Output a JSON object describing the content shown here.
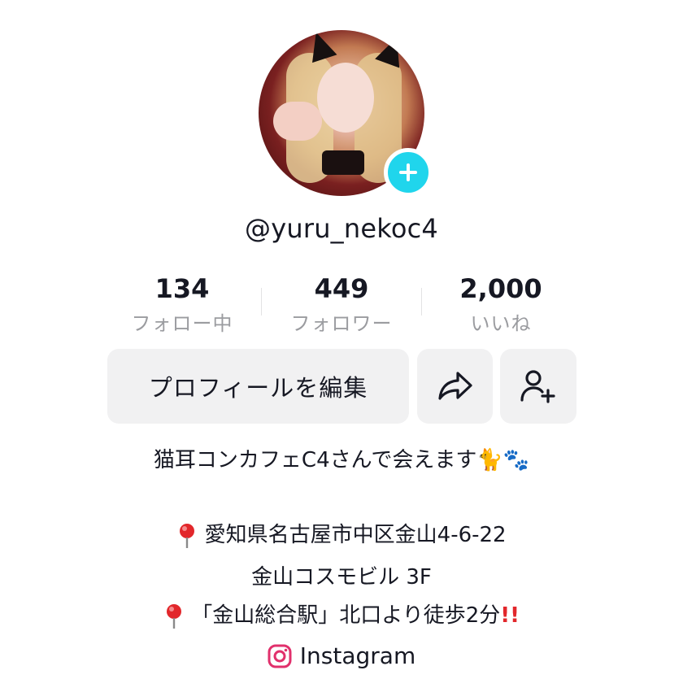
{
  "profile": {
    "username": "@yuru_nekoc4"
  },
  "stats": [
    {
      "value": "134",
      "label": "フォロー中"
    },
    {
      "value": "449",
      "label": "フォロワー"
    },
    {
      "value": "2,000",
      "label": "いいね"
    }
  ],
  "actions": {
    "edit_label": "プロフィールを編集"
  },
  "bio": {
    "line1": "猫耳コンカフェC4さんで会えます🐈🐾",
    "line2": "愛知県名古屋市中区金山4-6-22",
    "line3": "金山コスモビル 3F",
    "line4_text": "「金山総合駅」北口より徒歩2分",
    "line4_mark": "!!"
  },
  "links": {
    "instagram_label": "Instagram"
  },
  "colors": {
    "accent": "#20d5ec",
    "text": "#161823",
    "muted": "#9b9ca0",
    "button_bg": "#f1f1f2",
    "pin_red": "#e2272b",
    "instagram": "#e1306c"
  },
  "icons": {
    "avatar_badge": "plus-icon",
    "share": "share-arrow-icon",
    "add_friend": "add-user-icon",
    "location": "pushpin-icon",
    "instagram": "instagram-icon"
  }
}
